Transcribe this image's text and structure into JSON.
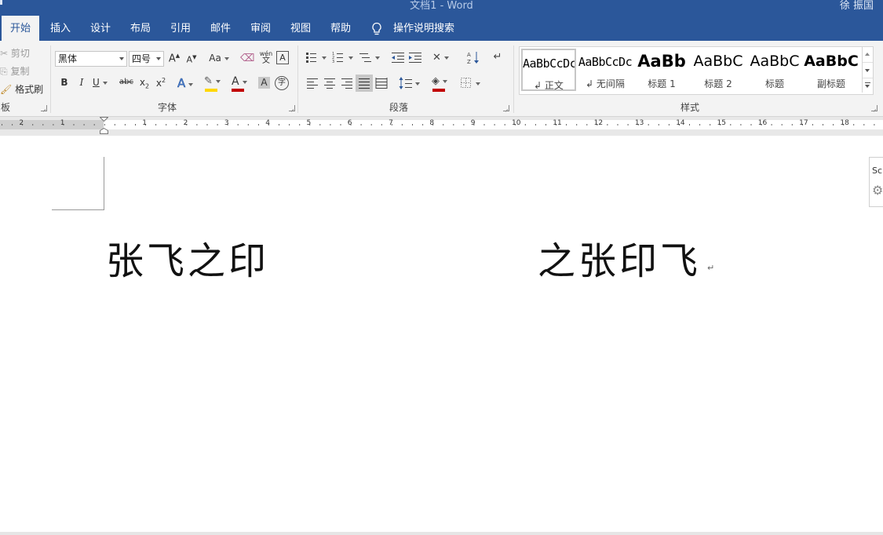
{
  "window": {
    "title": "文档1  -  Word",
    "user": "徐 振国"
  },
  "tabs": [
    {
      "label": "开始",
      "active": true
    },
    {
      "label": "插入"
    },
    {
      "label": "设计"
    },
    {
      "label": "布局"
    },
    {
      "label": "引用"
    },
    {
      "label": "邮件"
    },
    {
      "label": "审阅"
    },
    {
      "label": "视图"
    },
    {
      "label": "帮助"
    }
  ],
  "tell_me": "操作说明搜索",
  "clipboard": {
    "cut": "剪切",
    "copy": "复制",
    "format_painter": "格式刷",
    "group_label": "板"
  },
  "font": {
    "font_name": "黑体",
    "font_size": "四号",
    "group_label": "字体",
    "grow_glyph": "A",
    "shrink_glyph": "A",
    "case_glyph": "Aa",
    "phonetic_top": "wén",
    "phonetic_bottom": "文",
    "char_border_glyph": "A",
    "bold": "B",
    "italic": "I",
    "underline": "U",
    "strike": "abc",
    "subscript": "x",
    "subscript_mark": "2",
    "superscript": "x",
    "superscript_mark": "2",
    "effects_glyph": "A",
    "font_color_glyph": "A",
    "shading_glyph": "A",
    "enclose_glyph": "字",
    "font_color": "#c00000",
    "highlight_color": "#ffd700"
  },
  "paragraph": {
    "group_label": "段落",
    "shading_color": "#c00000"
  },
  "styles": {
    "group_label": "样式",
    "items": [
      {
        "preview": "AaBbCcDc",
        "name": "正文",
        "has_mark": true,
        "selected": true
      },
      {
        "preview": "AaBbCcDc",
        "name": "无间隔",
        "has_mark": true
      },
      {
        "preview": "AaBb",
        "name": "标题 1"
      },
      {
        "preview": "AaBbC",
        "name": "标题 2"
      },
      {
        "preview": "AaBbC",
        "name": "标题"
      },
      {
        "preview": "AaBbC",
        "name": "副标题"
      }
    ]
  },
  "ruler": {
    "numbers": [
      "2",
      "1",
      "1",
      "2",
      "3",
      "4",
      "5",
      "6",
      "7",
      "8",
      "9",
      "10",
      "11",
      "12",
      "13",
      "14",
      "15",
      "16",
      "17",
      "18"
    ]
  },
  "document": {
    "text_left": "张飞之印",
    "text_right": "之张印飞",
    "paragraph_mark": "↵"
  },
  "side_panel": {
    "label": "Scr"
  },
  "colors": {
    "accent": "#2b579a",
    "ribbon_bg": "#f3f3f3"
  }
}
